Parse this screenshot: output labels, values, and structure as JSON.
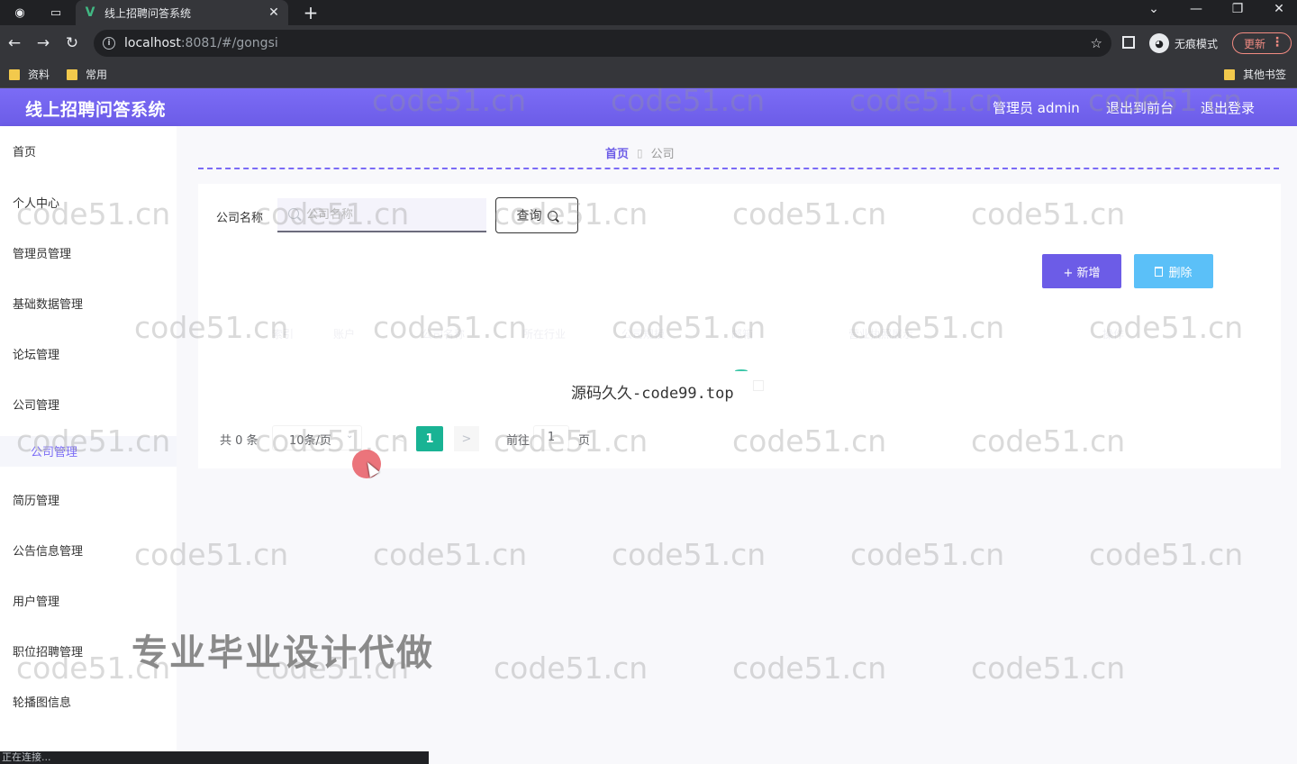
{
  "browser": {
    "tab_title": "线上招聘问答系统",
    "tab_close": "✕",
    "new_tab": "+",
    "url_host": "localhost",
    "url_rest": ":8081/#/gongsi",
    "incognito_label": "无痕模式",
    "update_label": "更新",
    "bookmarks": [
      "资料",
      "常用"
    ],
    "other_bookmarks": "其他书签",
    "status_text": "正在连接..."
  },
  "header": {
    "title": "线上招聘问答系统",
    "user": "管理员 admin",
    "to_front": "退出到前台",
    "logout": "退出登录"
  },
  "sidebar": {
    "items": [
      "首页",
      "个人中心",
      "管理员管理",
      "基础数据管理",
      "论坛管理",
      "公司管理"
    ],
    "sub_item": "公司管理",
    "items_after": [
      "简历管理",
      "公告信息管理",
      "用户管理",
      "职位招聘管理",
      "轮播图信息"
    ]
  },
  "breadcrumb": {
    "home": "首页",
    "current": "公司"
  },
  "search": {
    "label": "公司名称",
    "placeholder": "公司名称",
    "button": "查询"
  },
  "actions": {
    "add": "+ 新增",
    "delete": "删除"
  },
  "table": {
    "headers": [
      "索引",
      "账户",
      "公司名称",
      "所在行业",
      "公司规模",
      "邮箱",
      "营业执照展示",
      "操作"
    ]
  },
  "loading_text": "源码久久-code99.top",
  "pagination": {
    "total": "共 0 条",
    "page_size": "10条/页",
    "prev": "<",
    "current_page": "1",
    "next": ">",
    "goto_label": "前往",
    "goto_value": "1",
    "page_unit": "页"
  },
  "overlay": {
    "promo": "专业毕业设计代做",
    "watermark": "code51.cn"
  },
  "colors": {
    "header": "#6c5ce7",
    "accent": "#7b6cf6",
    "delete": "#5bc0f8",
    "page_active": "#19b394"
  },
  "icons": [
    "back-icon",
    "forward-icon",
    "reload-icon",
    "info-icon",
    "star-icon",
    "incognito-icon",
    "folder-icon",
    "search-icon",
    "trash-icon"
  ]
}
